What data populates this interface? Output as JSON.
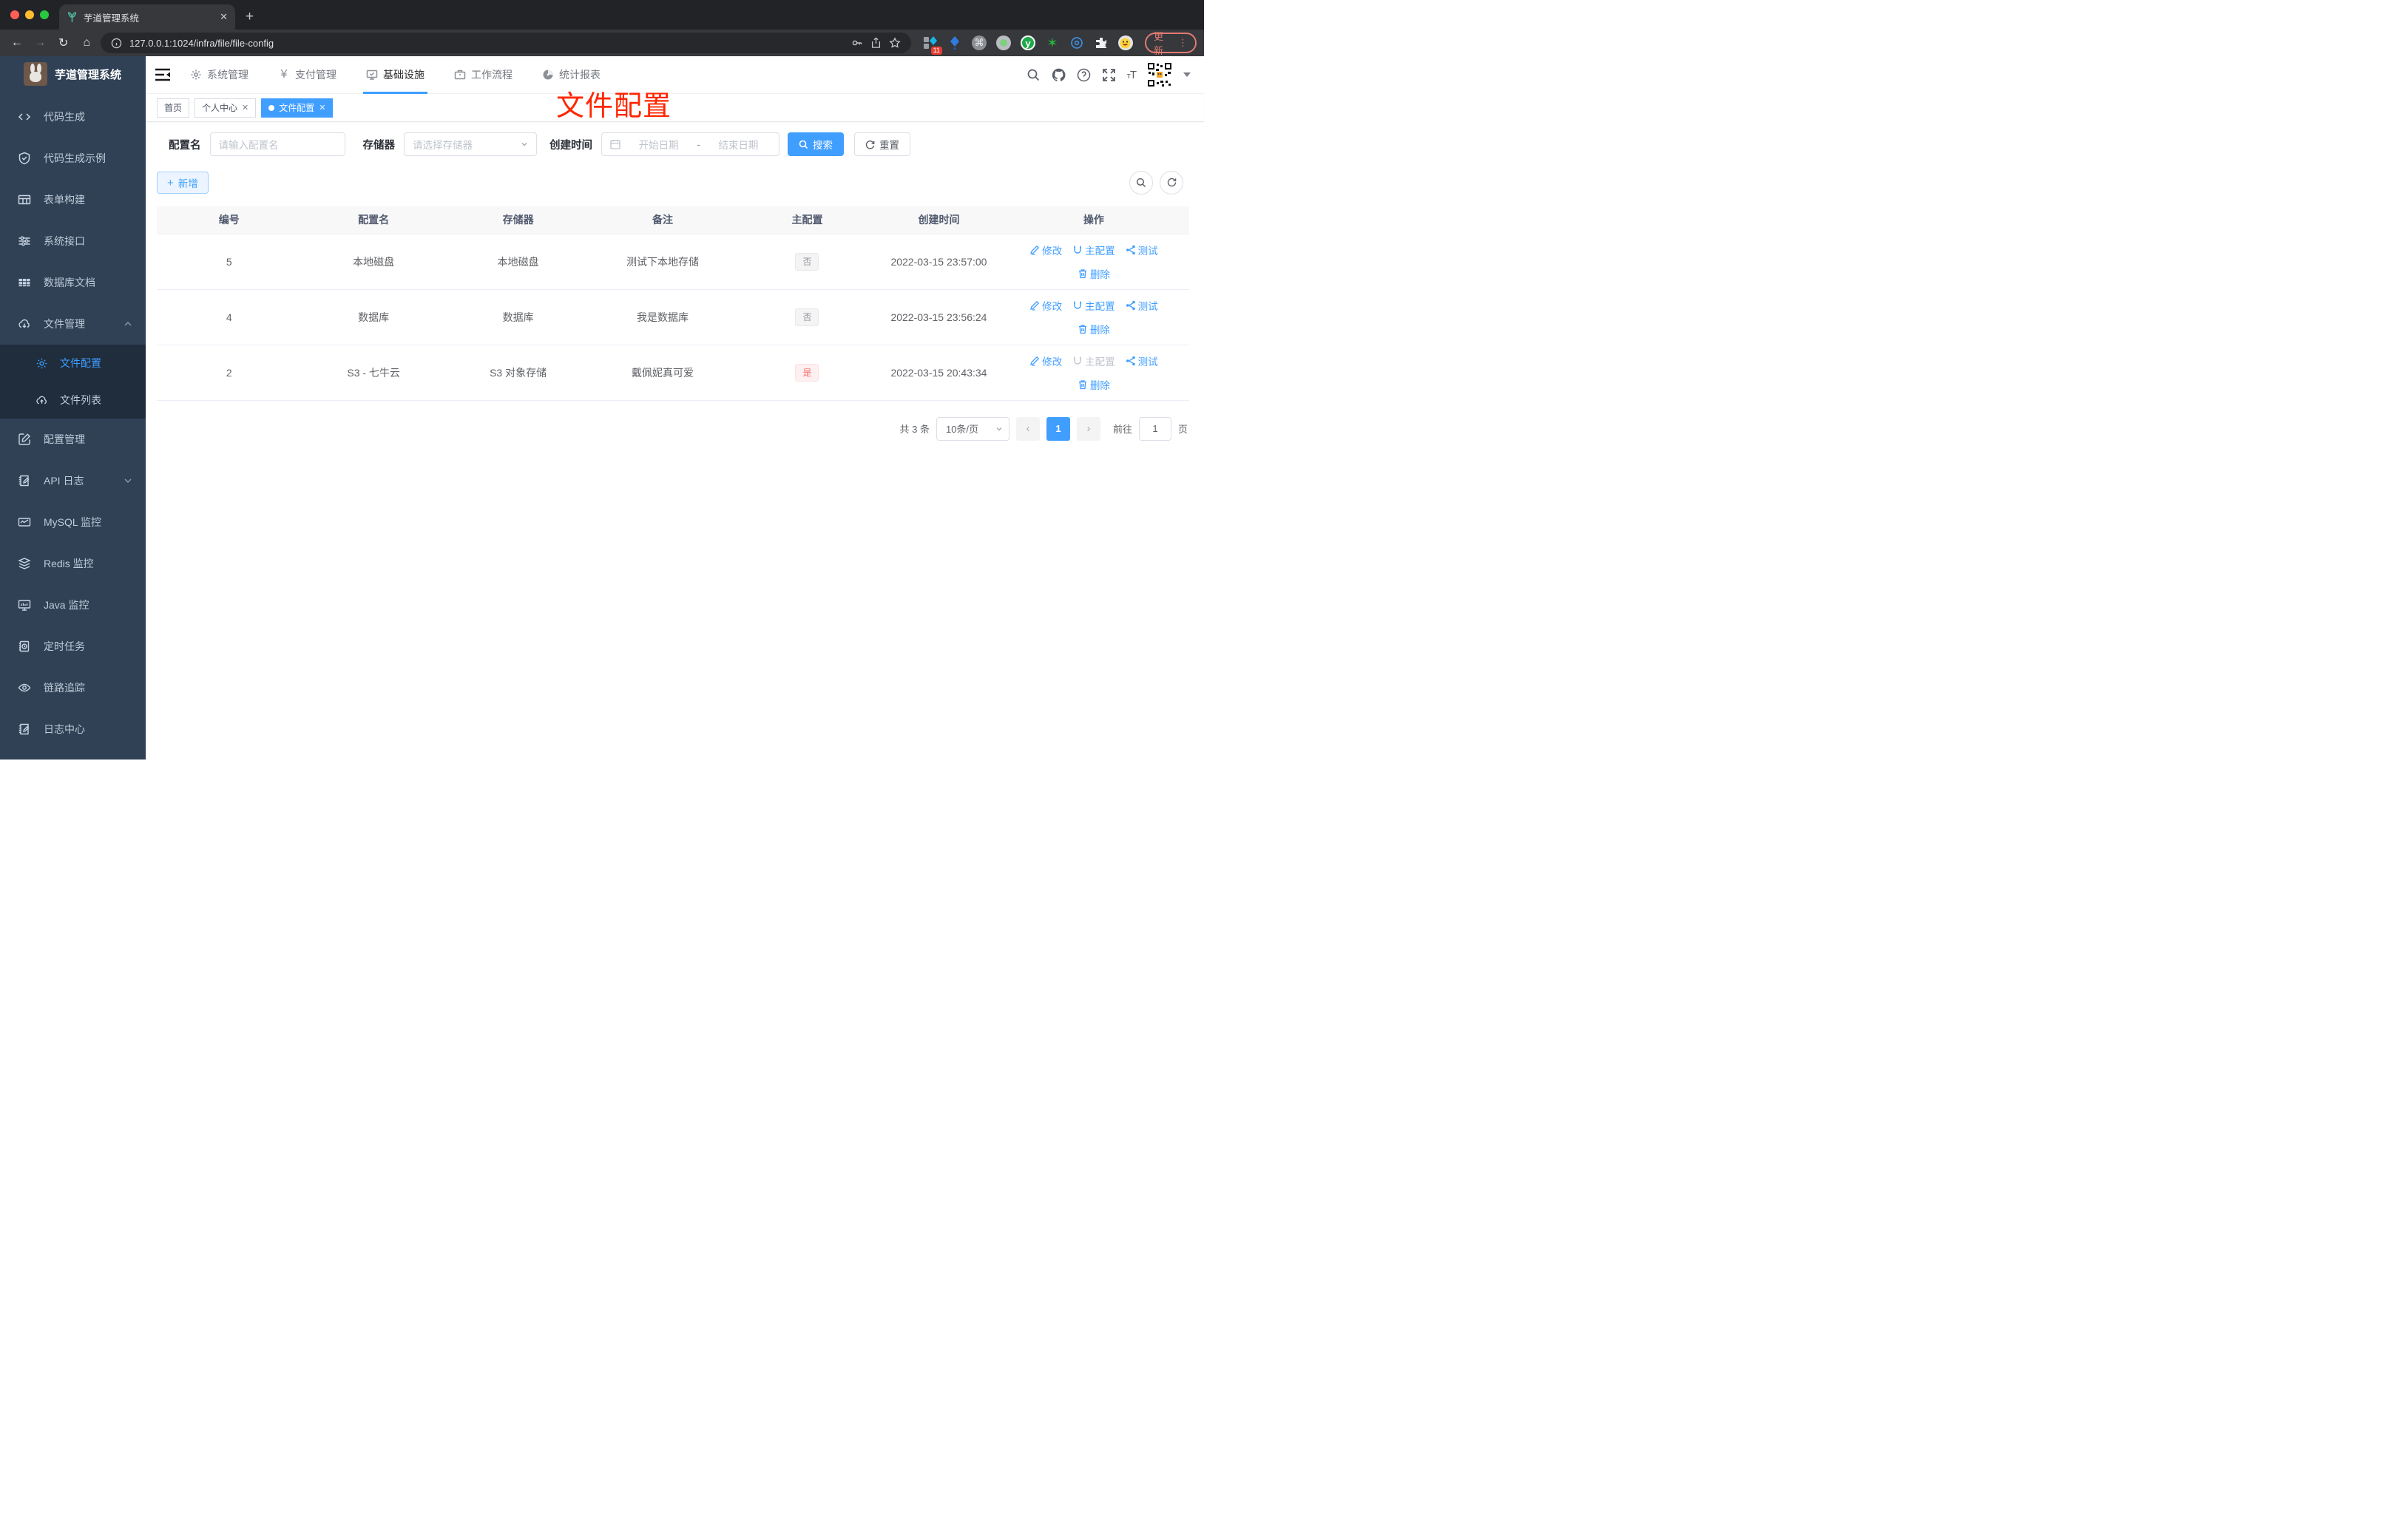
{
  "browser": {
    "tab_title": "芋道管理系统",
    "url": "127.0.0.1:1024/infra/file/file-config",
    "update_label": "更新",
    "ext_badge": "11",
    "icons": [
      "back-icon",
      "forward-icon",
      "reload-icon",
      "home-icon",
      "info-icon",
      "key-icon",
      "share-icon",
      "star-icon",
      "extensions",
      "emoji-icon"
    ]
  },
  "sidebar": {
    "logo_title": "芋道管理系统",
    "items": [
      {
        "label": "代码生成",
        "icon": "code-icon"
      },
      {
        "label": "代码生成示例",
        "icon": "shield-check-icon"
      },
      {
        "label": "表单构建",
        "icon": "form-icon"
      },
      {
        "label": "系统接口",
        "icon": "sliders-icon"
      },
      {
        "label": "数据库文档",
        "icon": "table-icon"
      },
      {
        "label": "文件管理",
        "icon": "cloud-download-icon",
        "expanded": true
      },
      {
        "label": "文件配置",
        "icon": "gear-icon",
        "active": true,
        "sub": true
      },
      {
        "label": "文件列表",
        "icon": "cloud-upload-icon",
        "sub": true
      },
      {
        "label": "配置管理",
        "icon": "edit-square-icon"
      },
      {
        "label": "API 日志",
        "icon": "log-edit-icon",
        "collapsed": true
      },
      {
        "label": "MySQL 监控",
        "icon": "chart-icon"
      },
      {
        "label": "Redis 监控",
        "icon": "layers-icon"
      },
      {
        "label": "Java 监控",
        "icon": "monitor-icon"
      },
      {
        "label": "定时任务",
        "icon": "schedule-icon"
      },
      {
        "label": "链路追踪",
        "icon": "eye-icon"
      },
      {
        "label": "日志中心",
        "icon": "log-edit-icon"
      }
    ]
  },
  "topnav": {
    "items": [
      {
        "label": "系统管理",
        "icon": "gear-icon"
      },
      {
        "label": "支付管理",
        "icon": "yen-icon"
      },
      {
        "label": "基础设施",
        "icon": "monitor-check-icon",
        "active": true
      },
      {
        "label": "工作流程",
        "icon": "briefcase-icon"
      },
      {
        "label": "统计报表",
        "icon": "dashboard-icon"
      }
    ]
  },
  "tags": {
    "items": [
      {
        "label": "首页"
      },
      {
        "label": "个人中心",
        "closable": true
      },
      {
        "label": "文件配置",
        "active": true,
        "closable": true
      }
    ]
  },
  "annotation": {
    "text": "文件配置",
    "color": "#ff2600"
  },
  "filters": {
    "name_label": "配置名",
    "name_placeholder": "请输入配置名",
    "storage_label": "存储器",
    "storage_placeholder": "请选择存储器",
    "time_label": "创建时间",
    "start_placeholder": "开始日期",
    "range_separator": "-",
    "end_placeholder": "结束日期",
    "search_label": "搜索",
    "reset_label": "重置"
  },
  "toolbar": {
    "add_label": "新增"
  },
  "table": {
    "headers": [
      "编号",
      "配置名",
      "存储器",
      "备注",
      "主配置",
      "创建时间",
      "操作"
    ],
    "action_labels": {
      "edit": "修改",
      "master": "主配置",
      "test": "测试",
      "del": "删除"
    },
    "rows": [
      {
        "id": "5",
        "name": "本地磁盘",
        "storage": "本地磁盘",
        "remark": "测试下本地存储",
        "master": "否",
        "master_type": "info",
        "time": "2022-03-15 23:57:00",
        "master_action_disabled": false
      },
      {
        "id": "4",
        "name": "数据库",
        "storage": "数据库",
        "remark": "我是数据库",
        "master": "否",
        "master_type": "info",
        "time": "2022-03-15 23:56:24",
        "master_action_disabled": false
      },
      {
        "id": "2",
        "name": "S3 - 七牛云",
        "storage": "S3 对象存储",
        "remark": "戴佩妮真可爱",
        "master": "是",
        "master_type": "danger",
        "time": "2022-03-15 20:43:34",
        "master_action_disabled": true
      }
    ]
  },
  "pagination": {
    "total": "共 3 条",
    "page_size": "10条/页",
    "prev": "‹",
    "current_page": "1",
    "next": "›",
    "goto_label": "前往",
    "goto_value": "1",
    "unit_label": "页"
  },
  "colors": {
    "accent": "#409eff",
    "danger": "#f56c6c",
    "annotation_red": "#ff2600",
    "sidebar_bg": "#304156",
    "submenu_bg": "#1f2d3d"
  }
}
